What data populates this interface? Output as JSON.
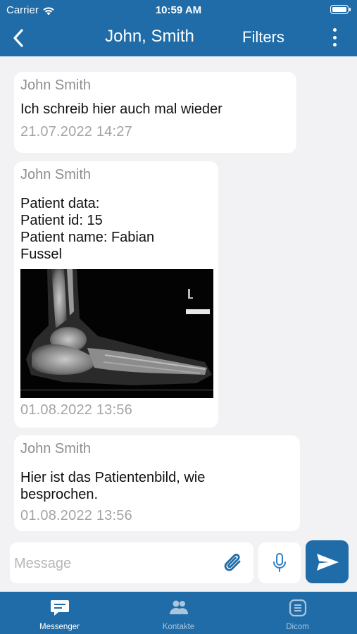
{
  "status_bar": {
    "carrier": "Carrier",
    "time": "10:59 AM"
  },
  "header": {
    "title": "John, Smith",
    "filters_label": "Filters"
  },
  "messages": [
    {
      "sender": "John Smith",
      "text": "Ich schreib hier auch mal wieder",
      "timestamp": "21.07.2022  14:27"
    },
    {
      "sender": "John Smith",
      "text_lines": [
        "Patient data:",
        "Patient id: 15",
        "Patient name: Fabian",
        "Fussel"
      ],
      "image": "foot x-ray",
      "timestamp": "01.08.2022  13:56"
    },
    {
      "sender": "John Smith",
      "text_lines": [
        "Hier ist das Patientenbild, wie",
        "besprochen."
      ],
      "timestamp": "01.08.2022  13:56"
    }
  ],
  "composer": {
    "placeholder": "Message"
  },
  "tabs": [
    {
      "label": "Messenger",
      "icon": "chat-bubble-icon",
      "active": true
    },
    {
      "label": "Kontakte",
      "icon": "people-icon",
      "active": false
    },
    {
      "label": "Dicom",
      "icon": "document-list-icon",
      "active": false
    }
  ],
  "colors": {
    "primary": "#1f6ca8",
    "background": "#f2f2f4",
    "bubble": "#ffffff",
    "inactive_tab": "#a9c6de"
  }
}
